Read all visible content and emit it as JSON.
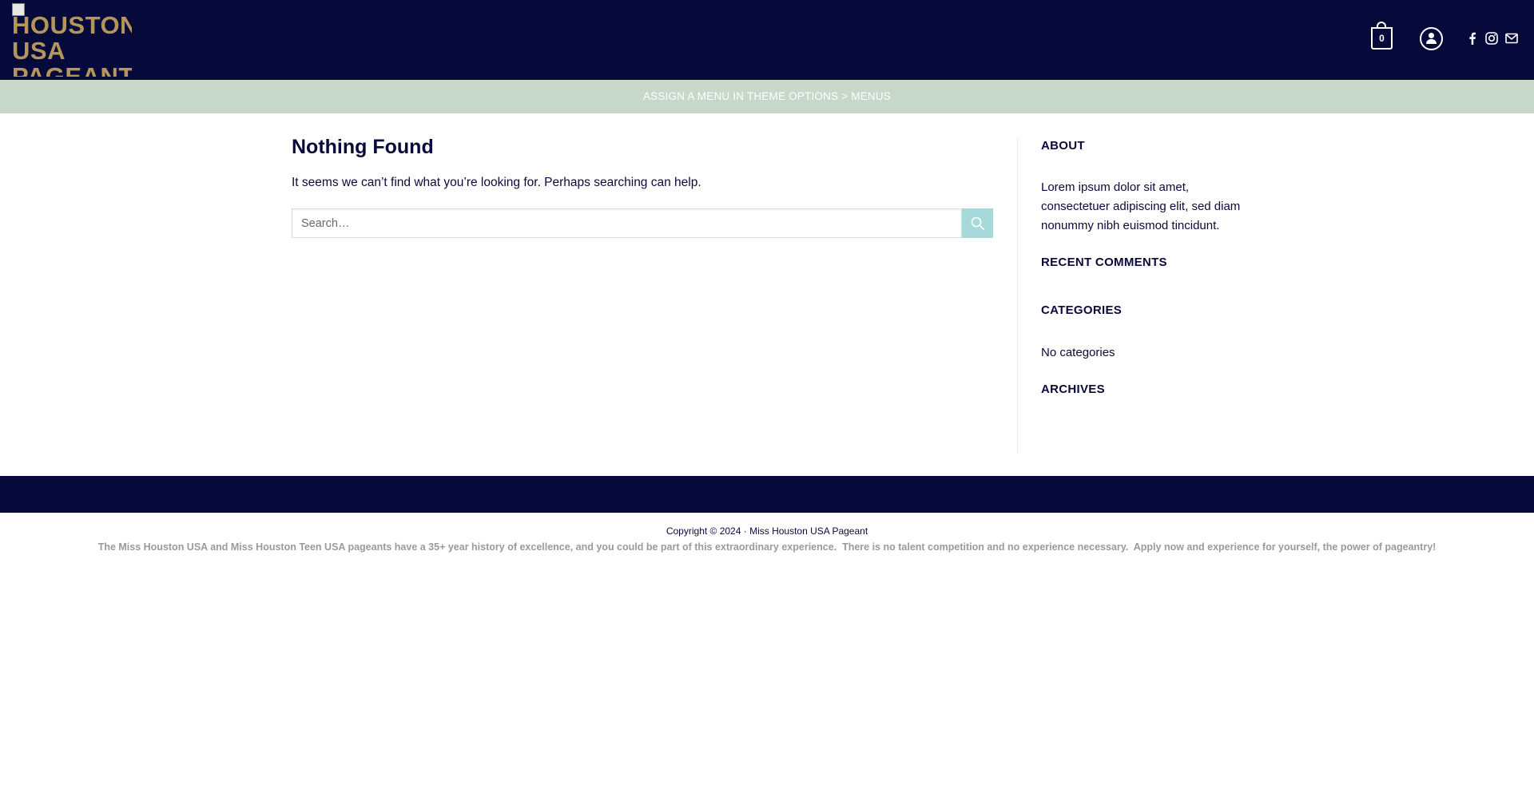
{
  "header": {
    "logo_text": "HOUSTON USA PAGEANT",
    "cart_count": "0",
    "social": [
      "facebook-icon",
      "instagram-icon",
      "envelope-icon"
    ],
    "colors": {
      "header_bg": "#060a3b",
      "logo_gold": "#b5965a"
    }
  },
  "nav": {
    "menu_notice": "Assign a menu in Theme Options > Menus",
    "bg_color": "#c5d8c9"
  },
  "main": {
    "title": "Nothing Found",
    "message": "It seems we can’t find what you’re looking for. Perhaps searching can help.",
    "search": {
      "placeholder": "Search…",
      "button_color": "#a6d9d9"
    }
  },
  "sidebar": {
    "about_title": "About",
    "about_text": "Lorem ipsum dolor sit amet, consectetuer adipiscing elit, sed diam nonummy nibh euismod tincidunt.",
    "recent_comments_title": "Recent Comments",
    "categories_title": "Categories",
    "categories_text": "No categories",
    "archives_title": "Archives"
  },
  "footer": {
    "copyright_prefix": "Copyright © 2024 · ",
    "site_name": "Miss Houston USA Pageant",
    "tagline": "The Miss Houston USA and Miss Houston Teen USA pageants have a 35+ year history of excellence, and you could be part of this extraordinary experience.  There is no talent competition and no experience necessary.  Apply now and experience for yourself, the power of pageantry!"
  }
}
